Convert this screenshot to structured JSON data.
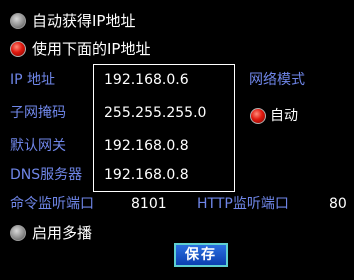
{
  "network": {
    "dhcp_option": {
      "label": "自动获得IP地址",
      "checked": false
    },
    "static_option": {
      "label": "使用下面的IP地址",
      "checked": true
    },
    "fields": [
      {
        "label": "IP  地址",
        "value": "192.168.0.6"
      },
      {
        "label": "子网掩码",
        "value": "255.255.255.0"
      },
      {
        "label": "默认网关",
        "value": "192.168.0.8"
      },
      {
        "label": "DNS服务器",
        "value": "192.168.0.8"
      }
    ],
    "mode": {
      "label": "网络模式",
      "option_label": "自动",
      "checked": true
    },
    "command_port": {
      "label": "命令监听端口",
      "value": "8101"
    },
    "http_port": {
      "label": "HTTP监听端口",
      "value": "80"
    },
    "multicast": {
      "label": "启用多播",
      "checked": false
    },
    "save_label": "保存"
  },
  "colors": {
    "background": "#000000",
    "label_blue": "#6f86e8",
    "text_white": "#ffffff",
    "radio_checked": "#e0180e",
    "button_blue": "#1a55cc",
    "button_border": "#5fd0d0"
  }
}
